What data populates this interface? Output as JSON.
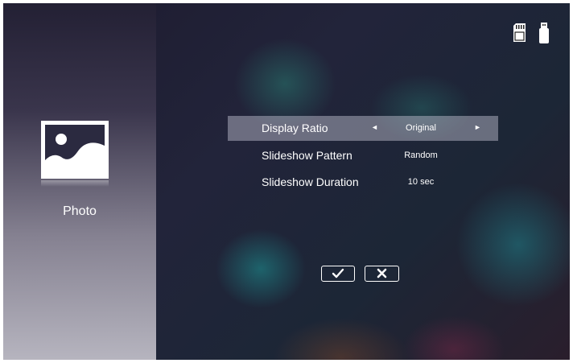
{
  "sidebar": {
    "title": "Photo",
    "icon": "photo-icon"
  },
  "menu": {
    "rows": [
      {
        "label": "Display Ratio",
        "value": "Original",
        "left_arrow": "◄",
        "right_arrow": "►"
      },
      {
        "label": "Slideshow Pattern",
        "value": "Random"
      },
      {
        "label": "Slideshow Duration",
        "value": "10 sec"
      }
    ]
  },
  "buttons": {
    "confirm_icon": "check-icon",
    "cancel_icon": "close-icon"
  },
  "status_icons": [
    "sd-card-icon",
    "usb-drive-icon"
  ]
}
